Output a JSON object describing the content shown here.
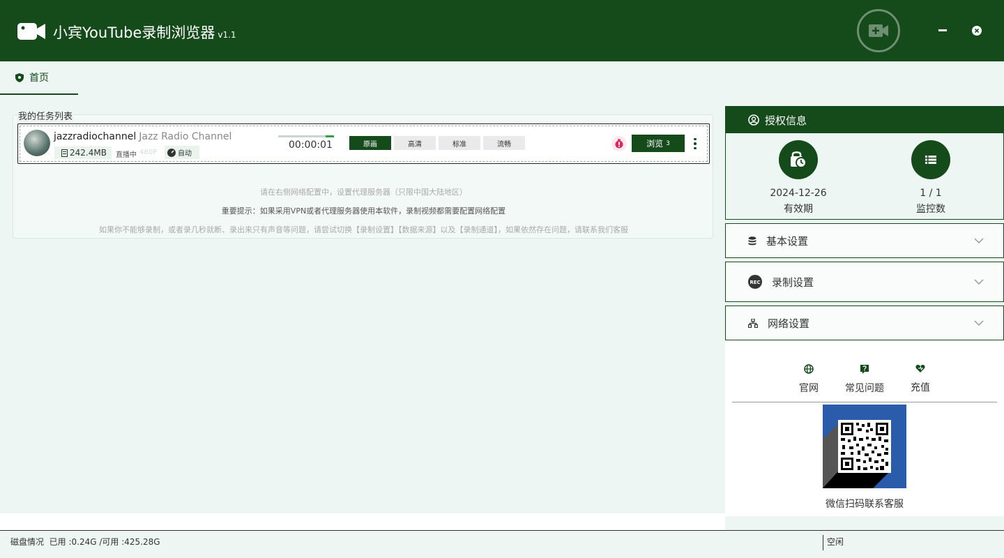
{
  "app": {
    "title": "小宾YouTube录制浏览器",
    "version": "v1.1"
  },
  "tabs": [
    {
      "label": "首页"
    }
  ],
  "task_list": {
    "title": "我的任务列表",
    "tasks": [
      {
        "channel_id": "jazzradiochannel",
        "channel_name": "Jazz Radio Channel",
        "size": "242.4MB",
        "status": "直播中",
        "status_extra": "480P",
        "mode": "自动",
        "progress": 0.15,
        "elapsed": "00:00:01",
        "qualities": [
          "原画",
          "高清",
          "标准",
          "流畅"
        ],
        "selected_quality": "原画",
        "browse_label": "浏览",
        "browse_count": "3"
      }
    ],
    "hints": [
      "请在右侧网络配置中，设置代理服务器（只限中国大陆地区）",
      "重要提示：如果采用VPN或者代理服务器使用本软件，录制视频都需要配置网络配置",
      "如果你不能够录制，或者录几秒就断、录出来只有声音等问题，请尝试切换【录制设置】【数据来源】以及【录制通道】，如果依然存在问题，请联系我们客服"
    ]
  },
  "auth": {
    "title": "授权信息",
    "expiry_value": "2024-12-26",
    "expiry_label": "有效期",
    "monitor_value": "1 / 1",
    "monitor_label": "监控数"
  },
  "settings": {
    "basic": "基本设置",
    "record": "录制设置",
    "network": "网络设置"
  },
  "links": {
    "website": "官网",
    "faq": "常见问题",
    "recharge": "充值",
    "qr_caption": "微信扫码联系客服",
    "rec_badge": "REC"
  },
  "status_bar": {
    "disk_label": "磁盘情况",
    "disk_used": "已用 :0.24G /可用 :425.28G",
    "state": "空闲"
  },
  "colors": {
    "primary": "#154a1b",
    "background": "#eef6f3",
    "progress": "#2fa046",
    "qr_bg": "#2a5cab"
  },
  "icons": [
    "camera-icon",
    "record-add-icon",
    "minimize-icon",
    "close-icon",
    "shield-icon",
    "user-circle-icon",
    "clock-lock-icon",
    "list-icon",
    "database-icon",
    "rec-icon",
    "network-icon",
    "globe-icon",
    "question-icon",
    "heart-icon",
    "chevron-down-icon"
  ]
}
